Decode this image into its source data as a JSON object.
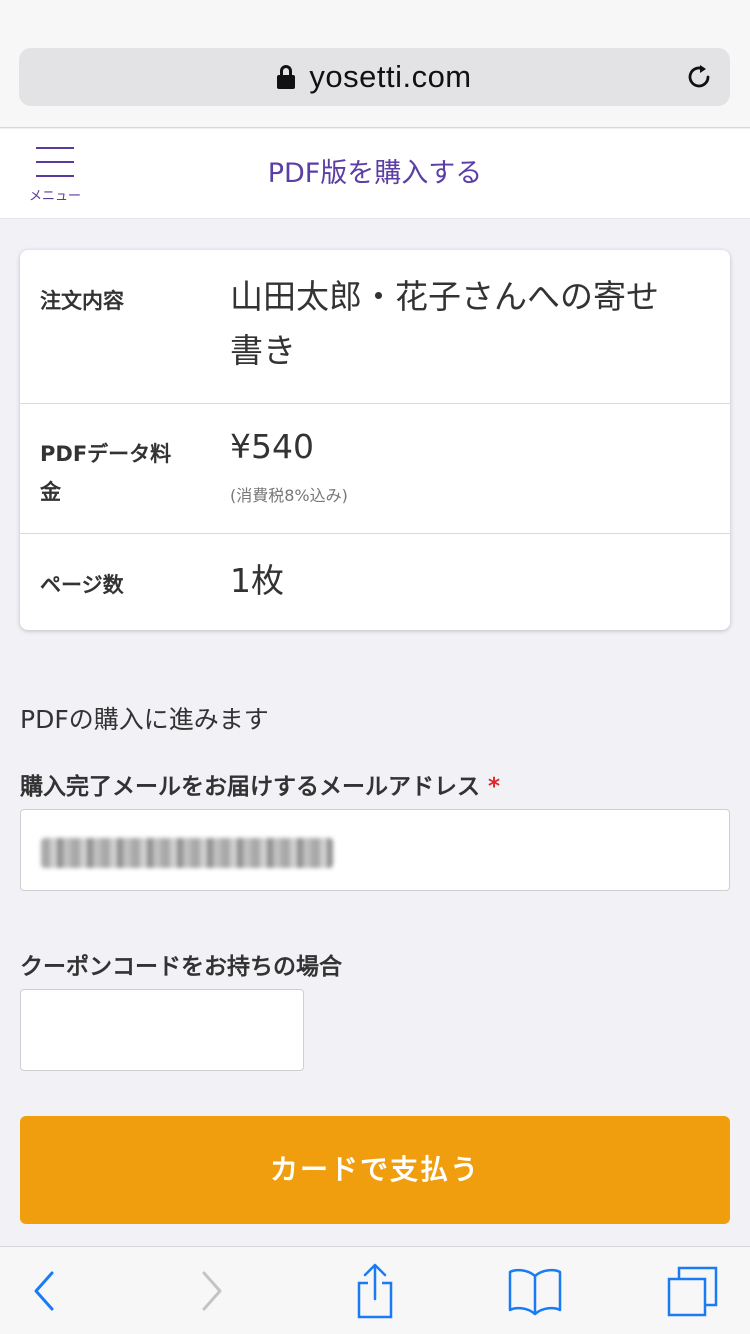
{
  "browser": {
    "url": "yosetti.com"
  },
  "header": {
    "title": "PDF版を購入する",
    "menu_label": "メニュー"
  },
  "order": {
    "rows": [
      {
        "label": "注文内容",
        "value_line1": "山田太郎・花子さんへの寄せ",
        "value_line2": "書き"
      },
      {
        "label_line1": "PDFデータ料",
        "label_line2": "金",
        "value": "¥540",
        "sub": "(消費税8%込み)"
      },
      {
        "label": "ページ数",
        "value": "1枚"
      }
    ]
  },
  "form": {
    "intro": "PDFの購入に進みます",
    "email_label": "購入完了メールをお届けするメールアドレス",
    "required_mark": "*",
    "coupon_label": "クーポンコードをお持ちの場合",
    "pay_button": "カードで支払う"
  },
  "colors": {
    "accent": "#5b3ea6",
    "pay_button": "#f09e0e",
    "required": "#e0262b",
    "ios_blue": "#1a7cf5"
  },
  "toolbar": {
    "icons": [
      "back-icon",
      "forward-icon",
      "share-icon",
      "bookmarks-icon",
      "tabs-icon"
    ]
  }
}
